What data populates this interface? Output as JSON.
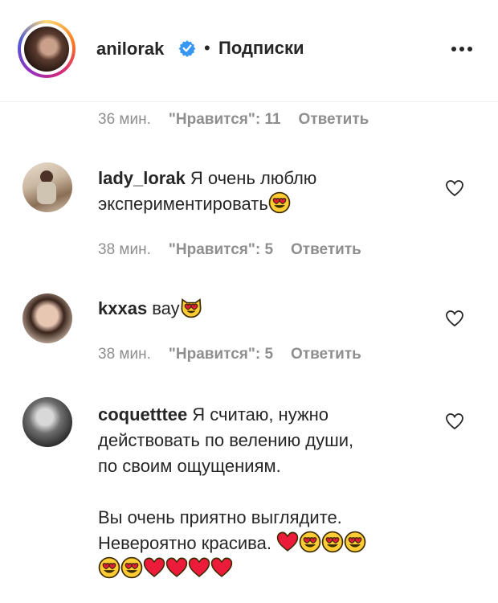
{
  "post": {
    "username": "anilorak",
    "separator": "•",
    "follow_label": "Подписки"
  },
  "top_meta": {
    "time": "36 мин.",
    "likes": "\"Нравится\": 11",
    "reply": "Ответить"
  },
  "comments": [
    {
      "username": "lady_lorak",
      "lines": [
        "Я очень люблю",
        "экспериментировать"
      ],
      "time": "38 мин.",
      "likes": "\"Нравится\": 5",
      "reply": "Ответить"
    },
    {
      "username": "kxxas",
      "lines": [
        "вау"
      ],
      "time": "38 мин.",
      "likes": "\"Нравится\": 5",
      "reply": "Ответить"
    },
    {
      "username": "coquetttee",
      "lines": [
        "Я считаю, нужно",
        "действовать по велению души,",
        "по своим ощущениям.",
        "",
        "Вы очень приятно выглядите.",
        "Невероятно красива."
      ]
    }
  ],
  "colors": {
    "text": "#262626",
    "muted": "#8e8e8e",
    "verified": "#3897f0",
    "heart_red": "#ed1b3a",
    "emoji_face": "#ffcc33"
  },
  "icons": [
    "verified-icon",
    "more-icon",
    "heart-icon",
    "heart-eyes-emoji",
    "heart-eyes-cat-emoji",
    "red-heart-emoji"
  ]
}
